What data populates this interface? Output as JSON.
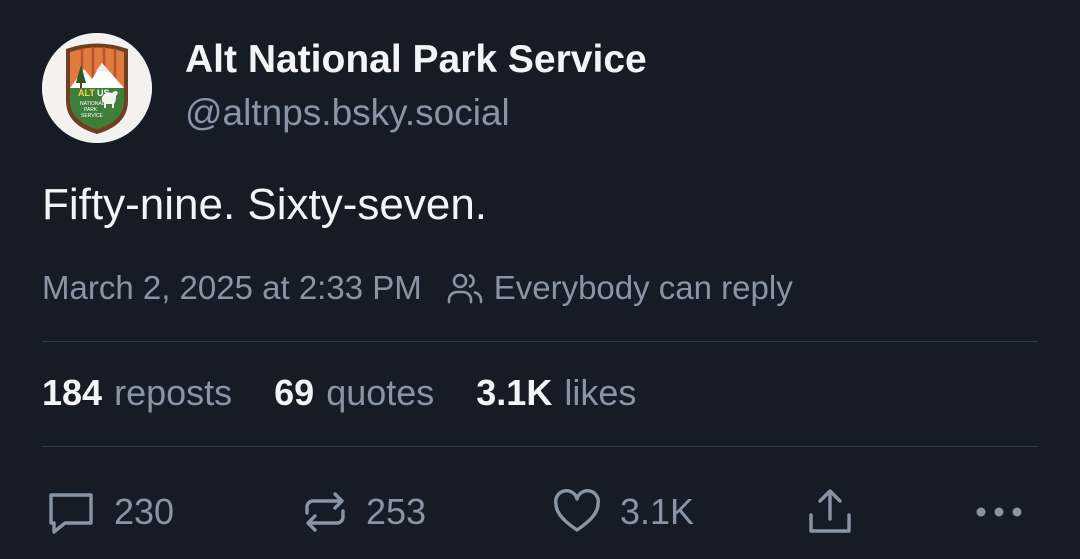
{
  "author": {
    "display_name": "Alt National Park Service",
    "handle": "@altnps.bsky.social",
    "avatar_icon": "alt-national-park-service-badge-logo"
  },
  "post": {
    "text": "Fifty-nine. Sixty-seven.",
    "timestamp": "March 2, 2025 at 2:33 PM",
    "reply_setting": "Everybody can reply"
  },
  "stats": {
    "reposts_count": "184",
    "reposts_label": "reposts",
    "quotes_count": "69",
    "quotes_label": "quotes",
    "likes_count": "3.1K",
    "likes_label": "likes"
  },
  "actions": {
    "reply_count": "230",
    "repost_count": "253",
    "like_count": "3.1K"
  },
  "colors": {
    "background": "#151c26",
    "primary_text": "#f2f4f7",
    "secondary_text": "#8895a6",
    "divider": "#2e3a4a"
  }
}
